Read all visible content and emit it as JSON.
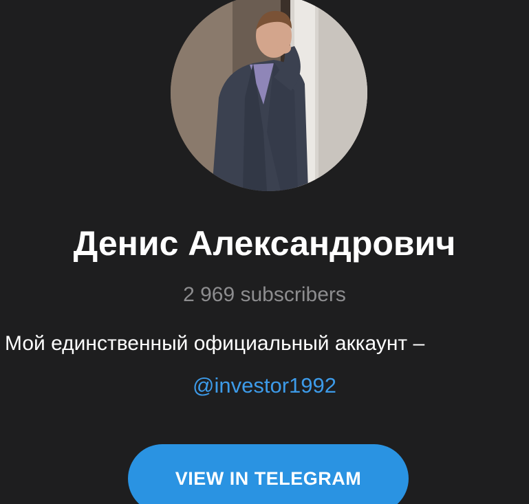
{
  "channel": {
    "name": "Денис Александрович",
    "subscribers": "2 969 subscribers",
    "description": "Мой единственный официальный аккаунт –",
    "username": "@investor1992"
  },
  "actions": {
    "view_button": "VIEW IN TELEGRAM"
  },
  "colors": {
    "background": "#1e1e1f",
    "accent": "#2a93e2",
    "link": "#3d9be9",
    "muted_text": "#8d8d8f"
  },
  "icons": {
    "avatar": "profile-photo"
  }
}
